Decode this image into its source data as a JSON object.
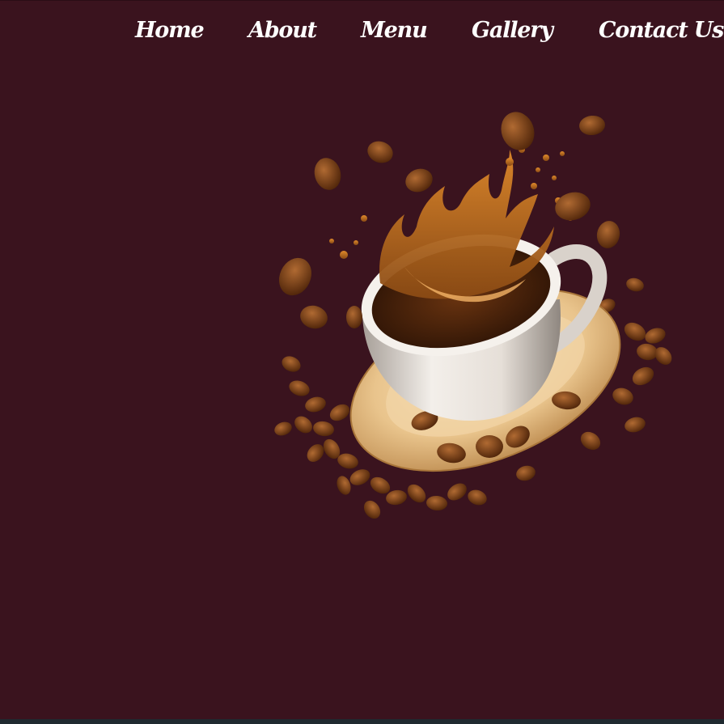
{
  "nav": {
    "items": [
      {
        "label": "Home"
      },
      {
        "label": "About"
      },
      {
        "label": "Menu"
      },
      {
        "label": "Gallery"
      },
      {
        "label": "Contact Us"
      }
    ]
  },
  "colors": {
    "background": "#3a131e",
    "nav_text": "#ffffff",
    "saucer": "#e9c48c",
    "cup": "#efeae4",
    "coffee": "#b4661c",
    "bean": "#7a3e15"
  },
  "hero": {
    "image": "coffee-cup-splash-with-beans"
  }
}
